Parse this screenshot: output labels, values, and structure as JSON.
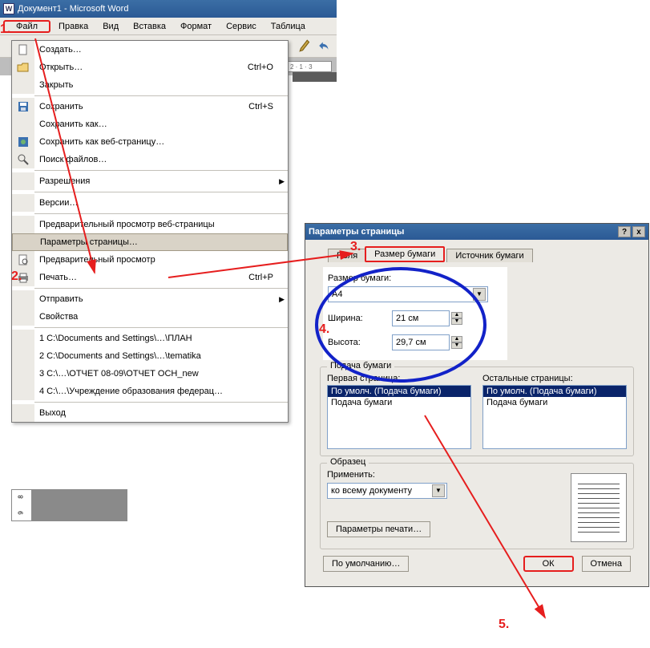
{
  "title": "Документ1 - Microsoft Word",
  "menus": {
    "file": "Файл",
    "edit": "Правка",
    "view": "Вид",
    "insert": "Вставка",
    "format": "Формат",
    "tools": "Сервис",
    "table": "Таблица"
  },
  "ruler_ticks": "2 · 1 · 3",
  "file_menu": {
    "create": "Создать…",
    "open": "Открыть…",
    "open_sc": "Ctrl+O",
    "close": "Закрыть",
    "save": "Сохранить",
    "save_sc": "Ctrl+S",
    "save_as": "Сохранить как…",
    "save_web": "Сохранить как веб-страницу…",
    "file_search": "Поиск файлов…",
    "permissions": "Разрешения",
    "versions": "Версии…",
    "web_preview": "Предварительный просмотр веб-страницы",
    "page_setup": "Параметры страницы…",
    "print_preview": "Предварительный просмотр",
    "print": "Печать…",
    "print_sc": "Ctrl+P",
    "send": "Отправить",
    "properties": "Свойства",
    "r1": "1 C:\\Documents and Settings\\…\\ПЛАН",
    "r2": "2 C:\\Documents and Settings\\…\\tematika",
    "r3": "3 C:\\…\\ОТЧЕТ 08-09\\ОТЧЕТ ОСН_new",
    "r4": "4 C:\\…\\Учреждение образования федерац…",
    "exit": "Выход"
  },
  "vruler": {
    "a": "8",
    "b": "9"
  },
  "dlg": {
    "title": "Параметры страницы",
    "help": "?",
    "close": "x",
    "tab_margins": "Поля",
    "tab_paper": "Размер бумаги",
    "tab_source": "Источник бумаги",
    "size_lbl": "Размер бумаги:",
    "size_val": "A4",
    "width_lbl": "Ширина:",
    "width_val": "21 см",
    "height_lbl": "Высота:",
    "height_val": "29,7 см",
    "feed_legend": "Подача бумаги",
    "first_page": "Первая страница:",
    "other_pages": "Остальные страницы:",
    "li_sel": "По умолч. (Подача бумаги)",
    "li1": "Подача бумаги",
    "sample_legend": "Образец",
    "apply_lbl": "Применить:",
    "apply_val": "ко всему документу",
    "print_opts": "Параметры печати…",
    "default_btn": "По умолчанию…",
    "ok": "ОК",
    "cancel": "Отмена"
  },
  "ann": {
    "s1": "1.",
    "s2": "2.",
    "s3": "3.",
    "s4": "4.",
    "s5": "5."
  }
}
